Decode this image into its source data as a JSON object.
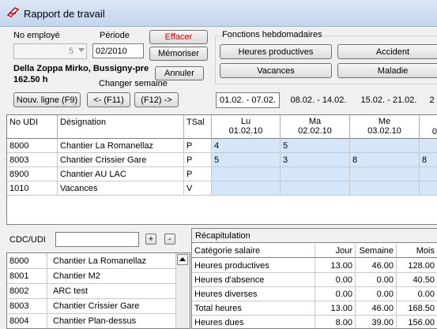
{
  "window": {
    "title": "Rapport de travail"
  },
  "header": {
    "employee_label": "No employé",
    "employee_value": "5",
    "period_label": "Période",
    "period_value": "02/2010",
    "employee_name": "Della Zoppa Mirko, Bussigny-pre",
    "hours": "162.50 h",
    "change_week_label": "Changer semaine"
  },
  "buttons": {
    "effacer": "Effacer",
    "memoriser": "Mémoriser",
    "annuler": "Annuler",
    "new_line": "Nouv. ligne (F9)",
    "prev": "<- (F11)",
    "next": "(F12) ->"
  },
  "weekly_functions": {
    "label": "Fonctions hebdomadaires",
    "items": [
      "Heures productives",
      "Accident",
      "Vacances",
      "Maladie"
    ]
  },
  "weeks": [
    "01.02. - 07.02.",
    "08.02. - 14.02.",
    "15.02. - 21.02.",
    "2"
  ],
  "grid": {
    "columns": [
      "No UDI",
      "Désignation",
      "TSal"
    ],
    "days": [
      {
        "day": "Lu",
        "date": "01.02.10"
      },
      {
        "day": "Ma",
        "date": "02.02.10"
      },
      {
        "day": "Me",
        "date": "03.02.10"
      },
      {
        "day": "",
        "date": "0"
      }
    ],
    "rows": [
      {
        "no": "8000",
        "name": "Chantier La Romanellaz",
        "tsal": "P",
        "vals": [
          "4",
          "5",
          "",
          ""
        ]
      },
      {
        "no": "8003",
        "name": "Chantier Crissier Gare",
        "tsal": "P",
        "vals": [
          "5",
          "3",
          "8",
          "8"
        ]
      },
      {
        "no": "8900",
        "name": "Chantier AU LAC",
        "tsal": "P",
        "vals": [
          "",
          "",
          "",
          ""
        ]
      },
      {
        "no": "1010",
        "name": "Vacances",
        "tsal": "V",
        "vals": [
          "",
          "",
          "",
          ""
        ]
      }
    ]
  },
  "cdc": {
    "label": "CDC/UDI",
    "value": "",
    "plus": "+",
    "minus": "-"
  },
  "udi_list": [
    {
      "no": "8000",
      "name": "Chantier La Romanellaz"
    },
    {
      "no": "8001",
      "name": "Chantier M2"
    },
    {
      "no": "8002",
      "name": "ARC test"
    },
    {
      "no": "8003",
      "name": "Chantier Crissier Gare"
    },
    {
      "no": "8004",
      "name": "Chantier Plan-dessus"
    }
  ],
  "recap": {
    "title": "Récapitulation",
    "headers": [
      "Catégorie salaire",
      "Jour",
      "Semaine",
      "Mois"
    ],
    "rows": [
      {
        "cat": "Heures productives",
        "jour": "13.00",
        "semaine": "46.00",
        "mois": "128.00"
      },
      {
        "cat": "Heures d'absence",
        "jour": "0.00",
        "semaine": "0.00",
        "mois": "40.50"
      },
      {
        "cat": "Heures diverses",
        "jour": "0.00",
        "semaine": "0.00",
        "mois": "0.00"
      },
      {
        "cat": "Total heures",
        "jour": "13.00",
        "semaine": "46.00",
        "mois": "168.50"
      },
      {
        "cat": "Heures dues",
        "jour": "8.00",
        "semaine": "39.00",
        "mois": "156.00"
      }
    ]
  },
  "colors": {
    "effacer_text": "#e00000",
    "highlight": "#d5e6f8"
  }
}
